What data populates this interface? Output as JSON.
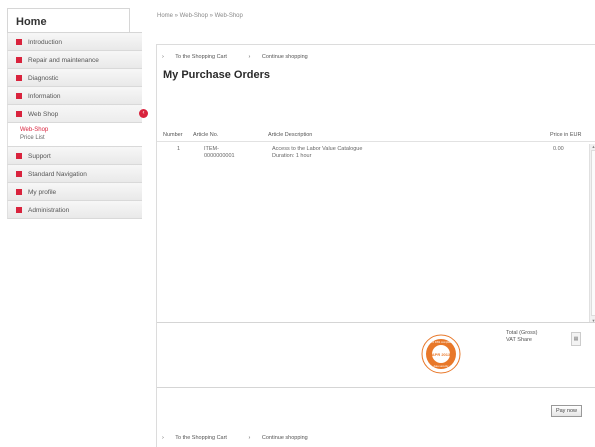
{
  "sidebar": {
    "home_label": "Home",
    "items": [
      {
        "label": "Introduction"
      },
      {
        "label": "Repair and maintenance"
      },
      {
        "label": "Diagnostic"
      },
      {
        "label": "Information"
      },
      {
        "label": "Web Shop"
      },
      {
        "label": "Support"
      },
      {
        "label": "Standard Navigation"
      },
      {
        "label": "My profile"
      },
      {
        "label": "Administration"
      }
    ],
    "webshop_sub": [
      "Web-Shop",
      "Price List"
    ],
    "collapse_glyph": "‹"
  },
  "breadcrumb": "Home » Web-Shop » Web-Shop",
  "links": {
    "to_cart": "To the Shopping Cart",
    "continue": "Continue shopping",
    "bullet": "›"
  },
  "page_title": "My Purchase Orders",
  "table": {
    "headers": {
      "number": "Number",
      "article_no": "Article No.",
      "description": "Article Description",
      "price": "Price in EUR"
    },
    "rows": [
      {
        "number": "1",
        "article_no_1": "ITEM-",
        "article_no_2": "0000000001",
        "desc_1": "Access to the Labor Value Catalogue",
        "desc_2": "Duration: 1 hour",
        "price": "0.00"
      }
    ]
  },
  "totals": {
    "gross": "Total (Gross)",
    "vat": "VAT Share"
  },
  "seal": {
    "top_text": "PCI DSS compliant",
    "middle_text": "APR 2013",
    "bottom_text": "data security",
    "color": "#e8782a"
  },
  "buttons": {
    "pay_now": "Pay now"
  },
  "colors": {
    "accent": "#d9233d"
  }
}
